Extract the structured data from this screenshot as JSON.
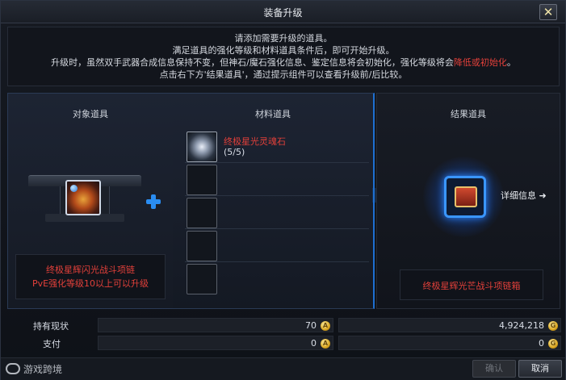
{
  "window": {
    "title": "装备升级"
  },
  "instructions": {
    "line1": "请添加需要升级的道具。",
    "line2": "满足道具的强化等级和材料道具条件后，即可开始升级。",
    "line3_pre": "升级时，虽然双手武器合成信息保持不变，但神石/魔石强化信息、鉴定信息将会初始化，强化等级将会",
    "line3_warn": "降低或初始化",
    "line3_post": "。",
    "line4": "点击右下方'结果道具'，通过提示组件可以查看升级前/后比较。"
  },
  "target": {
    "header": "对象道具",
    "name": "终极星辉闪光战斗项链",
    "requirement": "PvE强化等级10以上可以升级"
  },
  "material": {
    "header": "材料道具",
    "slots": [
      {
        "name": "终极星光灵魂石",
        "qty": "(5/5)"
      },
      {
        "name": "",
        "qty": ""
      },
      {
        "name": "",
        "qty": ""
      },
      {
        "name": "",
        "qty": ""
      },
      {
        "name": "",
        "qty": ""
      }
    ]
  },
  "result": {
    "header": "结果道具",
    "detail_label": "详细信息",
    "detail_arrow": "➜",
    "name": "终极星辉光芒战斗项链箱"
  },
  "currency": {
    "owned_label": "持有现状",
    "owned_a": "70",
    "owned_b": "4,924,218",
    "pay_label": "支付",
    "pay_a": "0",
    "pay_b": "0",
    "coin_a_symbol": "A",
    "coin_b_symbol": "G"
  },
  "buttons": {
    "close": "✕",
    "confirm": "确认",
    "cancel": "取消"
  },
  "watermark": "游戏跨境",
  "colors": {
    "accent_blue": "#1e6fd1",
    "warning_red": "#e2403a"
  },
  "icons": {
    "close": "close-icon",
    "plus": "plus-icon",
    "arrows": "triple-chevron-right-icon",
    "coin": "coin-icon",
    "detail": "arrow-right-icon"
  }
}
